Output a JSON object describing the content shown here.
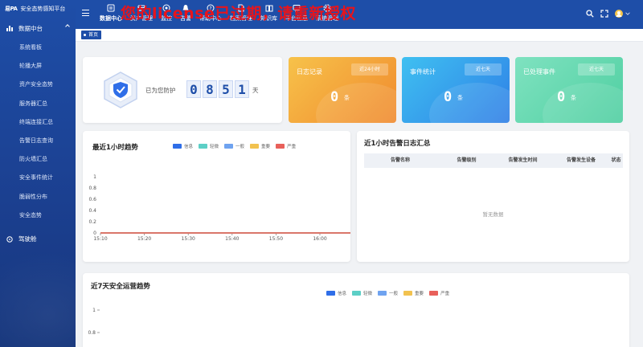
{
  "app": {
    "logo_mark": "易PA",
    "title": "安全态势感知平台"
  },
  "sidebar": {
    "group": "数据中台",
    "items": [
      "系统看板",
      "轮播大屏",
      "资产安全态势",
      "服务器汇总",
      "终端连接汇总",
      "告警日志查询",
      "防火墙汇总",
      "安全事件统计",
      "脆弱性分布",
      "安全态势"
    ],
    "group2": "驾驶舱"
  },
  "nav": {
    "items": [
      "数据中心",
      "资产管理",
      "监控",
      "告警",
      "帮助中心",
      "档案管理",
      "知识库",
      "平台信息",
      "系统管理"
    ]
  },
  "banner": "您的license已过期，请重新授权",
  "tags": {
    "home": "首页"
  },
  "protect": {
    "label": "已为您防护",
    "digits": [
      "0",
      "8",
      "5",
      "1"
    ],
    "unit": "天"
  },
  "stats": [
    {
      "title": "日志记录",
      "chip": "近24小时",
      "value": "0",
      "unit": "条"
    },
    {
      "title": "事件统计",
      "chip": "近七天",
      "value": "0",
      "unit": "条"
    },
    {
      "title": "已处理事件",
      "chip": "近七天",
      "value": "0",
      "unit": "条"
    }
  ],
  "trend_card": {
    "title": "最近1小时趋势"
  },
  "alarm_card": {
    "title": "近1小时告警日志汇总",
    "columns": [
      "告警名称",
      "告警级别",
      "告警发生时间",
      "告警发生设备",
      "状态"
    ],
    "empty": "暂无数据"
  },
  "week_card": {
    "title": "近7天安全运营趋势"
  },
  "chart_data": [
    {
      "type": "line",
      "x": [
        "15:10",
        "15:20",
        "15:30",
        "15:40",
        "15:50",
        "16:00"
      ],
      "series": [
        {
          "name": "信息",
          "color": "#2f6ee8",
          "values": [
            0,
            0,
            0,
            0,
            0,
            0
          ]
        },
        {
          "name": "轻微",
          "color": "#5ccfc6",
          "values": [
            0,
            0,
            0,
            0,
            0,
            0
          ]
        },
        {
          "name": "一般",
          "color": "#6fa3f0",
          "values": [
            0,
            0,
            0,
            0,
            0,
            0
          ]
        },
        {
          "name": "重要",
          "color": "#f2c24f",
          "values": [
            0,
            0,
            0,
            0,
            0,
            0
          ]
        },
        {
          "name": "严重",
          "color": "#e8605a",
          "values": [
            0,
            0,
            0,
            0,
            0,
            0
          ]
        }
      ],
      "y_ticks": [
        "0",
        "0.2",
        "0.4",
        "0.6",
        "0.8",
        "1"
      ],
      "ylim": [
        0,
        1
      ]
    },
    {
      "type": "line",
      "series": [
        {
          "name": "信息",
          "color": "#2f6ee8"
        },
        {
          "name": "轻微",
          "color": "#5ccfc6"
        },
        {
          "name": "一般",
          "color": "#6fa3f0"
        },
        {
          "name": "重要",
          "color": "#f2c24f"
        },
        {
          "name": "严重",
          "color": "#e8605a"
        }
      ],
      "y_ticks": [
        "1",
        "0.8"
      ],
      "ylim": [
        0,
        1
      ]
    }
  ]
}
